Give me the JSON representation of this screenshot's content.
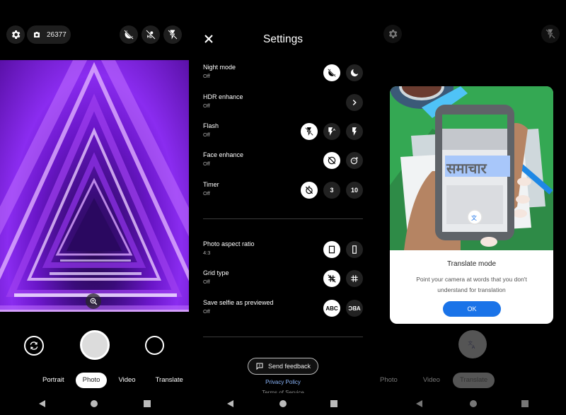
{
  "camera": {
    "photo_count": "26377",
    "top_icons": [
      "settings-icon",
      "photo-counter-icon",
      "night-off-icon",
      "hdr-off-icon",
      "flash-off-icon"
    ],
    "modes": [
      "Portrait",
      "Photo",
      "Video",
      "Translate"
    ],
    "active_mode": "Photo"
  },
  "settings": {
    "title": "Settings",
    "rows": [
      {
        "label": "Night mode",
        "value": "Off",
        "options": [
          "night-off",
          "night-on"
        ],
        "selected": 0
      },
      {
        "label": "HDR enhance",
        "value": "Off",
        "options": [
          "chevron-right"
        ],
        "selected": -1
      },
      {
        "label": "Flash",
        "value": "Off",
        "options": [
          "flash-off",
          "flash-auto",
          "flash-on"
        ],
        "selected": 0
      },
      {
        "label": "Face enhance",
        "value": "Off",
        "options": [
          "face-off",
          "face-on"
        ],
        "selected": 0
      },
      {
        "label": "Timer",
        "value": "Off",
        "options": [
          "timer-off",
          "3",
          "10"
        ],
        "selected": 0
      },
      {
        "label": "Photo aspect ratio",
        "value": "4:3",
        "options": [
          "ratio-4-3",
          "ratio-16-9"
        ],
        "selected": 0
      },
      {
        "label": "Grid type",
        "value": "Off",
        "options": [
          "grid-off",
          "grid-3x3"
        ],
        "selected": 0
      },
      {
        "label": "Save selfie as previewed",
        "value": "Off",
        "options": [
          "ABC",
          "ABC-mirrored"
        ],
        "selected": 0
      }
    ],
    "feedback_label": "Send feedback",
    "privacy_label": "Privacy Policy",
    "tos_label": "Terms of Service"
  },
  "translate": {
    "dialog_title": "Translate mode",
    "dialog_body": "Point your camera at words that you don't understand for translation",
    "ok_label": "OK",
    "illustration_word": "समाचार",
    "modes": [
      "Photo",
      "Video",
      "Translate"
    ],
    "active_mode": "Translate"
  },
  "colors": {
    "accent": "#1a73e8",
    "link": "#8ab4f8",
    "illustration_green": "#34a853"
  }
}
